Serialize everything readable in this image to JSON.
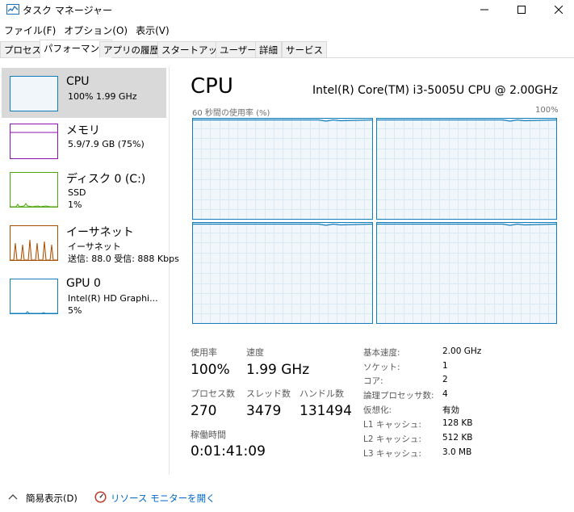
{
  "window": {
    "title": "タスク マネージャー"
  },
  "menu": [
    "ファイル(F)",
    "オプション(O)",
    "表示(V)"
  ],
  "tabs": [
    "プロセス",
    "パフォーマンス",
    "アプリの履歴",
    "スタートアップ",
    "ユーザー",
    "詳細",
    "サービス"
  ],
  "active_tab": "パフォーマンス",
  "sidebar": {
    "items": [
      {
        "title": "CPU",
        "line1": "100%  1.99 GHz",
        "line2": "",
        "line3": "",
        "color": "#117dbb"
      },
      {
        "title": "メモリ",
        "line1": "5.9/7.9 GB (75%)",
        "line2": "",
        "line3": "",
        "color": "#8b12ae"
      },
      {
        "title": "ディスク 0 (C:)",
        "line1": "SSD",
        "line2": "1%",
        "line3": "",
        "color": "#4da60c"
      },
      {
        "title": "イーサネット",
        "line1": "イーサネット",
        "line2": "送信: 88.0  受信: 888 Kbps",
        "line3": "",
        "color": "#a74f01"
      },
      {
        "title": "GPU 0",
        "line1": "Intel(R) HD Graphi...",
        "line2": "5%",
        "line3": "",
        "color": "#117dbb"
      }
    ]
  },
  "main": {
    "title": "CPU",
    "model": "Intel(R) Core(TM) i3-5005U CPU @ 2.00GHz",
    "graph_caption_left": "60 秒間の使用率 (%)",
    "graph_caption_right": "100%",
    "core_count": 4,
    "stats": {
      "utilization_label": "使用率",
      "utilization": "100%",
      "speed_label": "速度",
      "speed": "1.99 GHz",
      "processes_label": "プロセス数",
      "processes": "270",
      "threads_label": "スレッド数",
      "threads": "3479",
      "handles_label": "ハンドル数",
      "handles": "131494",
      "uptime_label": "稼働時間",
      "uptime": "0:01:41:09"
    },
    "specs": [
      {
        "label": "基本速度:",
        "value": "2.00 GHz"
      },
      {
        "label": "ソケット:",
        "value": "1"
      },
      {
        "label": "コア:",
        "value": "2"
      },
      {
        "label": "論理プロセッサ数:",
        "value": "4"
      },
      {
        "label": "仮想化:",
        "value": "有効"
      },
      {
        "label": "L1 キャッシュ:",
        "value": "128 KB"
      },
      {
        "label": "L2 キャッシュ:",
        "value": "512 KB"
      },
      {
        "label": "L3 キャッシュ:",
        "value": "3.0 MB"
      }
    ]
  },
  "footer": {
    "fewer_details": "簡易表示(D)",
    "resource_monitor": "リソース モニターを開く"
  },
  "icons": {
    "app": "task-manager-icon",
    "minimize": "minimize-icon",
    "maximize": "maximize-icon",
    "close": "close-icon",
    "chevron": "chevron-up-icon",
    "monitor": "resource-monitor-icon"
  },
  "colors": {
    "cpu_accent": "#117dbb",
    "graph_fill": "#f1f6fa",
    "grid": "#d9eaf4",
    "link": "#0066cc"
  }
}
